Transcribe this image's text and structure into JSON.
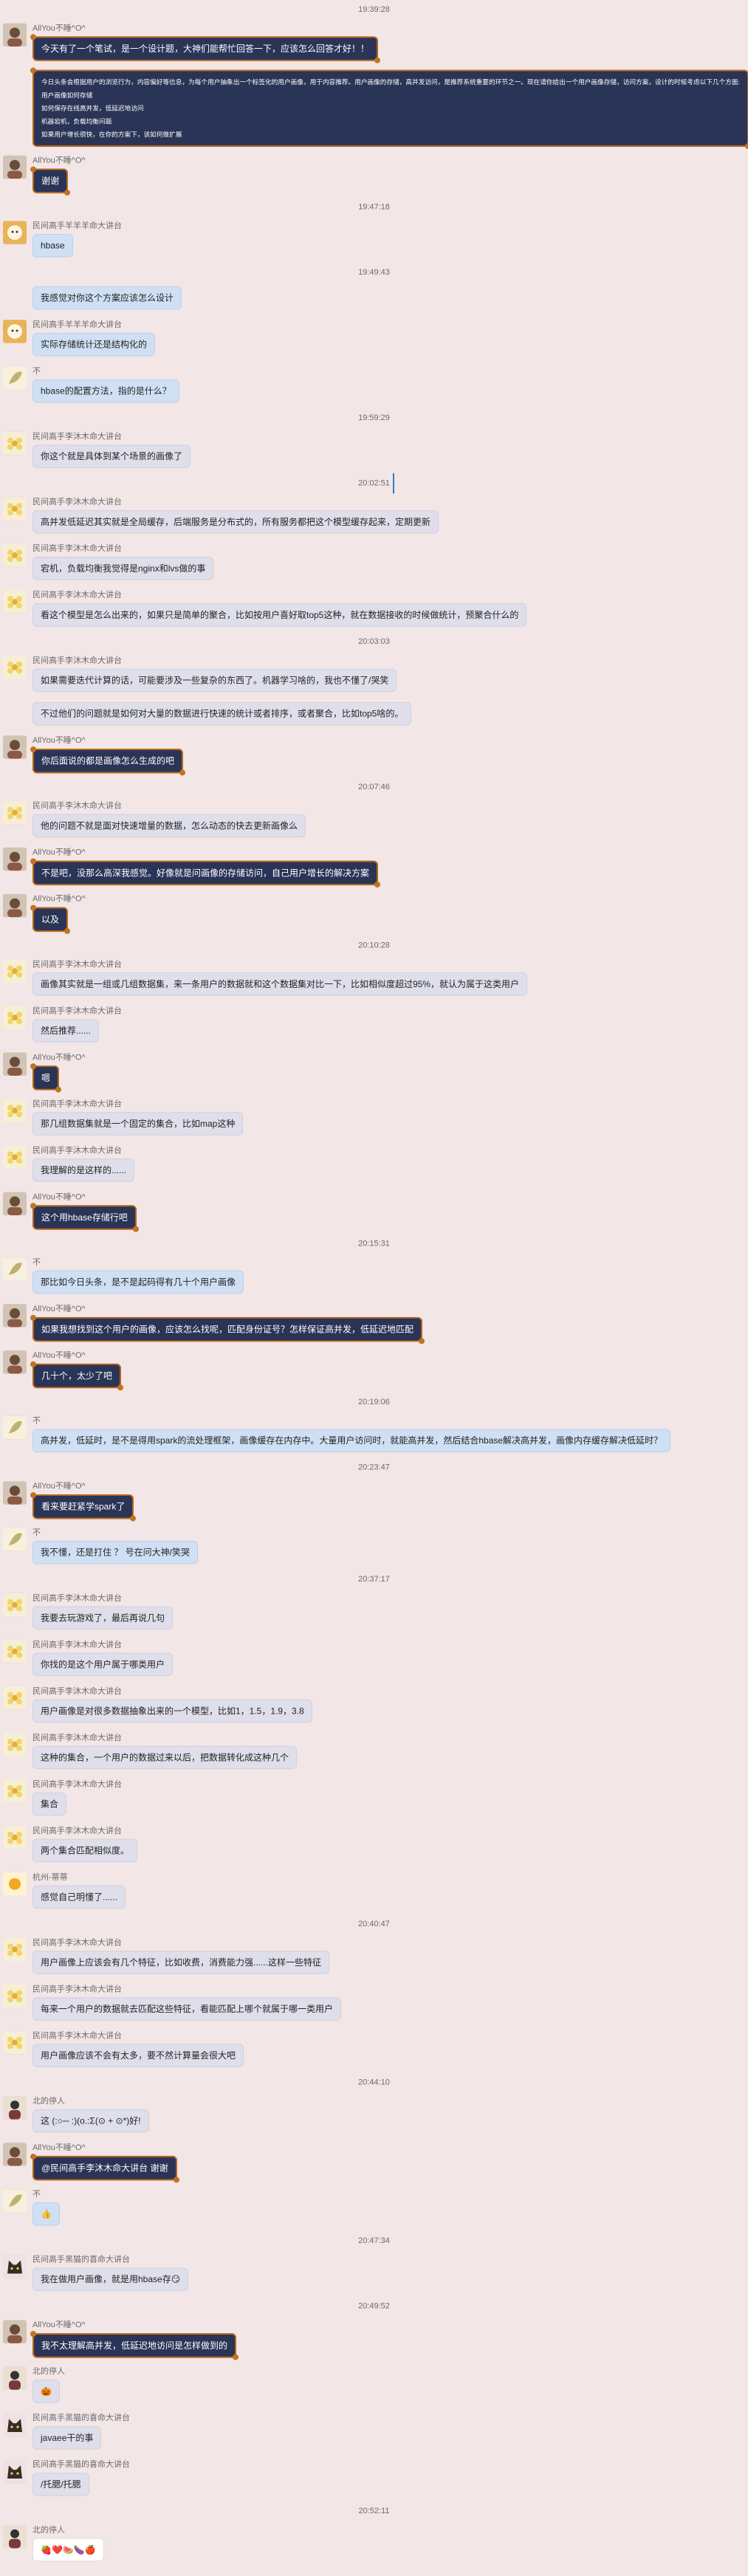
{
  "colors": {
    "background": "#f3e6e6",
    "dark_bubble": "#2a3456",
    "dark_border": "#b5651d",
    "blue_bubble": "#cfe0f4",
    "gray_bubble": "#dedfea"
  },
  "events": [
    {
      "type": "time",
      "text": "19:39:28"
    },
    {
      "type": "msg",
      "sender": "AllYou不睡^O^",
      "avatar": "me-icon",
      "style": "dark",
      "lines": [
        "今天有了一个笔试，是一个设计题，大神们能帮忙回答一下，应该怎么回答才好！！"
      ]
    },
    {
      "type": "msg",
      "sender": "",
      "avatar": "",
      "style": "dark",
      "lines": [
        "今日头条会根据用户的浏览行为，内容偏好等信息，为每个用户抽象出一个标签化的用户画像，用于内容推荐。用户画像的存储，高并发访问，是推荐系统重要的环节之一。现在请你给出一个用户画像存储，访问方案，设计的时候考虑以下几个方面:",
        "    用户画像如何存储",
        "    如何保存在线高并发，低延迟地访问",
        "    机器宕机，负载均衡问题",
        "    如果用户增长很快，在你的方案下，该如何做扩展"
      ]
    },
    {
      "type": "msg",
      "sender": "AllYou不睡^O^",
      "avatar": "me-icon",
      "style": "dark",
      "lines": [
        "谢谢"
      ]
    },
    {
      "type": "time",
      "text": "19:47:18"
    },
    {
      "type": "msg",
      "sender": "民间高手羊羊羊命大讲台",
      "avatar": "sheep-icon",
      "style": "blue",
      "lines": [
        "hbase"
      ]
    },
    {
      "type": "time",
      "text": "19:49:43"
    },
    {
      "type": "msg",
      "sender": "",
      "avatar": "",
      "style": "blue",
      "lines": [
        "我感觉对你这个方案应该怎么设计"
      ]
    },
    {
      "type": "msg",
      "sender": "民间高手羊羊羊命大讲台",
      "avatar": "sheep-icon",
      "style": "blue",
      "lines": [
        "实际存储统计还是结构化的"
      ]
    },
    {
      "type": "msg",
      "sender": "不",
      "avatar": "leaf-icon",
      "style": "blue",
      "lines": [
        "hbase的配置方法，指的是什么？"
      ]
    },
    {
      "type": "time",
      "text": "19:59:29"
    },
    {
      "type": "msg",
      "sender": "民间高手李沐木命大讲台",
      "avatar": "flower-icon",
      "style": "gray",
      "lines": [
        "你这个就是具体到某个场景的画像了"
      ]
    },
    {
      "type": "time",
      "text": "20:02:51"
    },
    {
      "type": "msg",
      "sender": "民间高手李沐木命大讲台",
      "avatar": "flower-icon",
      "style": "gray",
      "lines": [
        "高并发低延迟其实就是全局缓存，后端服务是分布式的，所有服务都把这个模型缓存起来，定期更新"
      ]
    },
    {
      "type": "msg",
      "sender": "民间高手李沐木命大讲台",
      "avatar": "flower-icon",
      "style": "gray",
      "lines": [
        "宕机，负载均衡我觉得是nginx和lvs做的事"
      ]
    },
    {
      "type": "msg",
      "sender": "民间高手李沐木命大讲台",
      "avatar": "flower-icon",
      "style": "gray",
      "lines": [
        "看这个模型是怎么出来的，如果只是简单的聚合，比如按用户喜好取top5这种，就在数据接收的时候做统计，预聚合什么的"
      ]
    },
    {
      "type": "time",
      "text": "20:03:03"
    },
    {
      "type": "msg",
      "sender": "民间高手李沐木命大讲台",
      "avatar": "flower-icon",
      "style": "gray",
      "lines": [
        "如果需要迭代计算的话，可能要涉及一些复杂的东西了。机器学习啥的，我也不懂了/哭笑"
      ]
    },
    {
      "type": "msg",
      "sender": "",
      "avatar": "",
      "style": "gray",
      "lines": [
        "不过他们的问题就是如何对大量的数据进行快速的统计或者排序，或者聚合，比如top5啥的。"
      ]
    },
    {
      "type": "msg",
      "sender": "AllYou不睡^O^",
      "avatar": "me-icon",
      "style": "dark",
      "lines": [
        "你后面说的都是画像怎么生成的吧"
      ]
    },
    {
      "type": "time",
      "text": "20:07:46"
    },
    {
      "type": "msg",
      "sender": "民间高手李沐木命大讲台",
      "avatar": "flower-icon",
      "style": "gray",
      "lines": [
        "他的问题不就是面对快速增量的数据，怎么动态的快去更新画像么"
      ]
    },
    {
      "type": "msg",
      "sender": "AllYou不睡^O^",
      "avatar": "me-icon",
      "style": "dark",
      "lines": [
        "不是吧，没那么高深我感觉。好像就是问画像的存储访问，自己用户增长的解决方案"
      ]
    },
    {
      "type": "msg",
      "sender": "AllYou不睡^O^",
      "avatar": "me-icon",
      "style": "dark",
      "lines": [
        "以及"
      ]
    },
    {
      "type": "time",
      "text": "20:10:28"
    },
    {
      "type": "msg",
      "sender": "民间高手李沐木命大讲台",
      "avatar": "flower-icon",
      "style": "gray",
      "lines": [
        "画像其实就是一组或几组数据集，来一条用户的数据就和这个数据集对比一下，比如相似度超过95%，就认为属于这类用户"
      ]
    },
    {
      "type": "msg",
      "sender": "民间高手李沐木命大讲台",
      "avatar": "flower-icon",
      "style": "gray",
      "lines": [
        "然后推荐......"
      ]
    },
    {
      "type": "msg",
      "sender": "AllYou不睡^O^",
      "avatar": "me-icon",
      "style": "dark",
      "lines": [
        "嗯"
      ]
    },
    {
      "type": "msg",
      "sender": "民间高手李沐木命大讲台",
      "avatar": "flower-icon",
      "style": "gray",
      "lines": [
        "那几组数据集就是一个固定的集合，比如map这种"
      ]
    },
    {
      "type": "msg",
      "sender": "民间高手李沐木命大讲台",
      "avatar": "flower-icon",
      "style": "gray",
      "lines": [
        "我理解的是这样的......"
      ]
    },
    {
      "type": "msg",
      "sender": "AllYou不睡^O^",
      "avatar": "me-icon",
      "style": "dark",
      "lines": [
        "这个用hbase存储行吧"
      ]
    },
    {
      "type": "time",
      "text": "20:15:31"
    },
    {
      "type": "msg",
      "sender": "不",
      "avatar": "leaf-icon",
      "style": "blue",
      "lines": [
        "那比如今日头条，是不是起码得有几十个用户画像"
      ]
    },
    {
      "type": "msg",
      "sender": "AllYou不睡^O^",
      "avatar": "me-icon",
      "style": "dark",
      "lines": [
        "如果我想找到这个用户的画像，应该怎么找呢，匹配身份证号？怎样保证高并发，低延迟地匹配"
      ]
    },
    {
      "type": "msg",
      "sender": "AllYou不睡^O^",
      "avatar": "me-icon",
      "style": "dark",
      "lines": [
        "几十个，太少了吧"
      ]
    },
    {
      "type": "time",
      "text": "20:19:06"
    },
    {
      "type": "msg",
      "sender": "不",
      "avatar": "leaf-icon",
      "style": "blue",
      "lines": [
        "高并发，低延时，是不是得用spark的流处理框架，画像缓存在内存中。大量用户访问时，就能高并发，然后结合hbase解决高并发，画像内存缓存解决低延时？"
      ]
    },
    {
      "type": "time",
      "text": "20:23:47"
    },
    {
      "type": "msg",
      "sender": "AllYou不睡^O^",
      "avatar": "me-icon",
      "style": "dark",
      "lines": [
        "看来要赶紧学spark了"
      ]
    },
    {
      "type": "msg",
      "sender": "不",
      "avatar": "leaf-icon",
      "style": "blue",
      "lines": [
        "我不懂，还是打住 ？ 号在问大神/笑哭"
      ]
    },
    {
      "type": "time",
      "text": "20:37:17"
    },
    {
      "type": "msg",
      "sender": "民间高手李沐木命大讲台",
      "avatar": "flower-icon",
      "style": "gray",
      "lines": [
        "我要去玩游戏了，最后再说几句"
      ]
    },
    {
      "type": "msg",
      "sender": "民间高手李沐木命大讲台",
      "avatar": "flower-icon",
      "style": "gray",
      "lines": [
        "你找的是这个用户属于哪类用户"
      ]
    },
    {
      "type": "msg",
      "sender": "民间高手李沐木命大讲台",
      "avatar": "flower-icon",
      "style": "gray",
      "lines": [
        "用户画像是对很多数据抽象出来的一个模型，比如1，1.5，1.9，3.8"
      ]
    },
    {
      "type": "msg",
      "sender": "民间高手李沐木命大讲台",
      "avatar": "flower-icon",
      "style": "gray",
      "lines": [
        "这种的集合，一个用户的数据过来以后，把数据转化成这种几个"
      ]
    },
    {
      "type": "msg",
      "sender": "民间高手李沐木命大讲台",
      "avatar": "flower-icon",
      "style": "gray",
      "lines": [
        "集合"
      ]
    },
    {
      "type": "msg",
      "sender": "民间高手李沐木命大讲台",
      "avatar": "flower-icon",
      "style": "gray",
      "lines": [
        "两个集合匹配相似度。"
      ]
    },
    {
      "type": "msg",
      "sender": "杭州-蒂蒂",
      "avatar": "sun-icon",
      "style": "gray",
      "lines": [
        "感觉自己明懂了......"
      ]
    },
    {
      "type": "time",
      "text": "20:40:47"
    },
    {
      "type": "msg",
      "sender": "民间高手李沐木命大讲台",
      "avatar": "flower-icon",
      "style": "gray",
      "lines": [
        "用户画像上应该会有几个特征，比如收费，消费能力强......这样一些特征"
      ]
    },
    {
      "type": "msg",
      "sender": "民间高手李沐木命大讲台",
      "avatar": "flower-icon",
      "style": "gray",
      "lines": [
        "每来一个用户的数据就去匹配这些特征，看能匹配上哪个就属于哪一类用户"
      ]
    },
    {
      "type": "msg",
      "sender": "民间高手李沐木命大讲台",
      "avatar": "flower-icon",
      "style": "gray",
      "lines": [
        "用户画像应该不会有太多，要不然计算量会很大吧"
      ]
    },
    {
      "type": "time",
      "text": "20:44:10"
    },
    {
      "type": "msg",
      "sender": "北的停人",
      "avatar": "person-icon",
      "style": "gray",
      "lines": [
        "这 (:○─ :)(o.:Σ(⊙ + ⊙*)好!"
      ]
    },
    {
      "type": "msg",
      "sender": "AllYou不睡^O^",
      "avatar": "me-icon",
      "style": "dark",
      "lines": [
        "@民间高手李沐木命大讲台 谢谢"
      ]
    },
    {
      "type": "msg",
      "sender": "不",
      "avatar": "leaf-icon",
      "style": "blue",
      "lines": [
        "👍"
      ]
    },
    {
      "type": "time",
      "text": "20:47:34"
    },
    {
      "type": "msg",
      "sender": "民间高手黑猫的喜命大讲台",
      "avatar": "cat-icon",
      "style": "gray",
      "lines": [
        "我在做用户画像，就是用hbase存😏"
      ]
    },
    {
      "type": "time",
      "text": "20:49:52"
    },
    {
      "type": "msg",
      "sender": "AllYou不睡^O^",
      "avatar": "me-icon",
      "style": "dark",
      "lines": [
        "我不太理解高并发，低延迟地访问是怎样做到的"
      ]
    },
    {
      "type": "msg",
      "sender": "北的停人",
      "avatar": "person-icon",
      "style": "gray",
      "lines": [
        "🎃"
      ]
    },
    {
      "type": "msg",
      "sender": "民间高手黑猫的喜命大讲台",
      "avatar": "cat-icon",
      "style": "gray",
      "lines": [
        "javaee干的事"
      ]
    },
    {
      "type": "msg",
      "sender": "民间高手黑猫的喜命大讲台",
      "avatar": "cat-icon",
      "style": "gray",
      "lines": [
        "/托腮/托腮"
      ]
    },
    {
      "type": "time",
      "text": "20:52:11"
    },
    {
      "type": "msg",
      "sender": "北的停人",
      "avatar": "person-icon",
      "style": "white",
      "lines": [
        "🍓❤️🍉🍆🍎"
      ]
    }
  ]
}
